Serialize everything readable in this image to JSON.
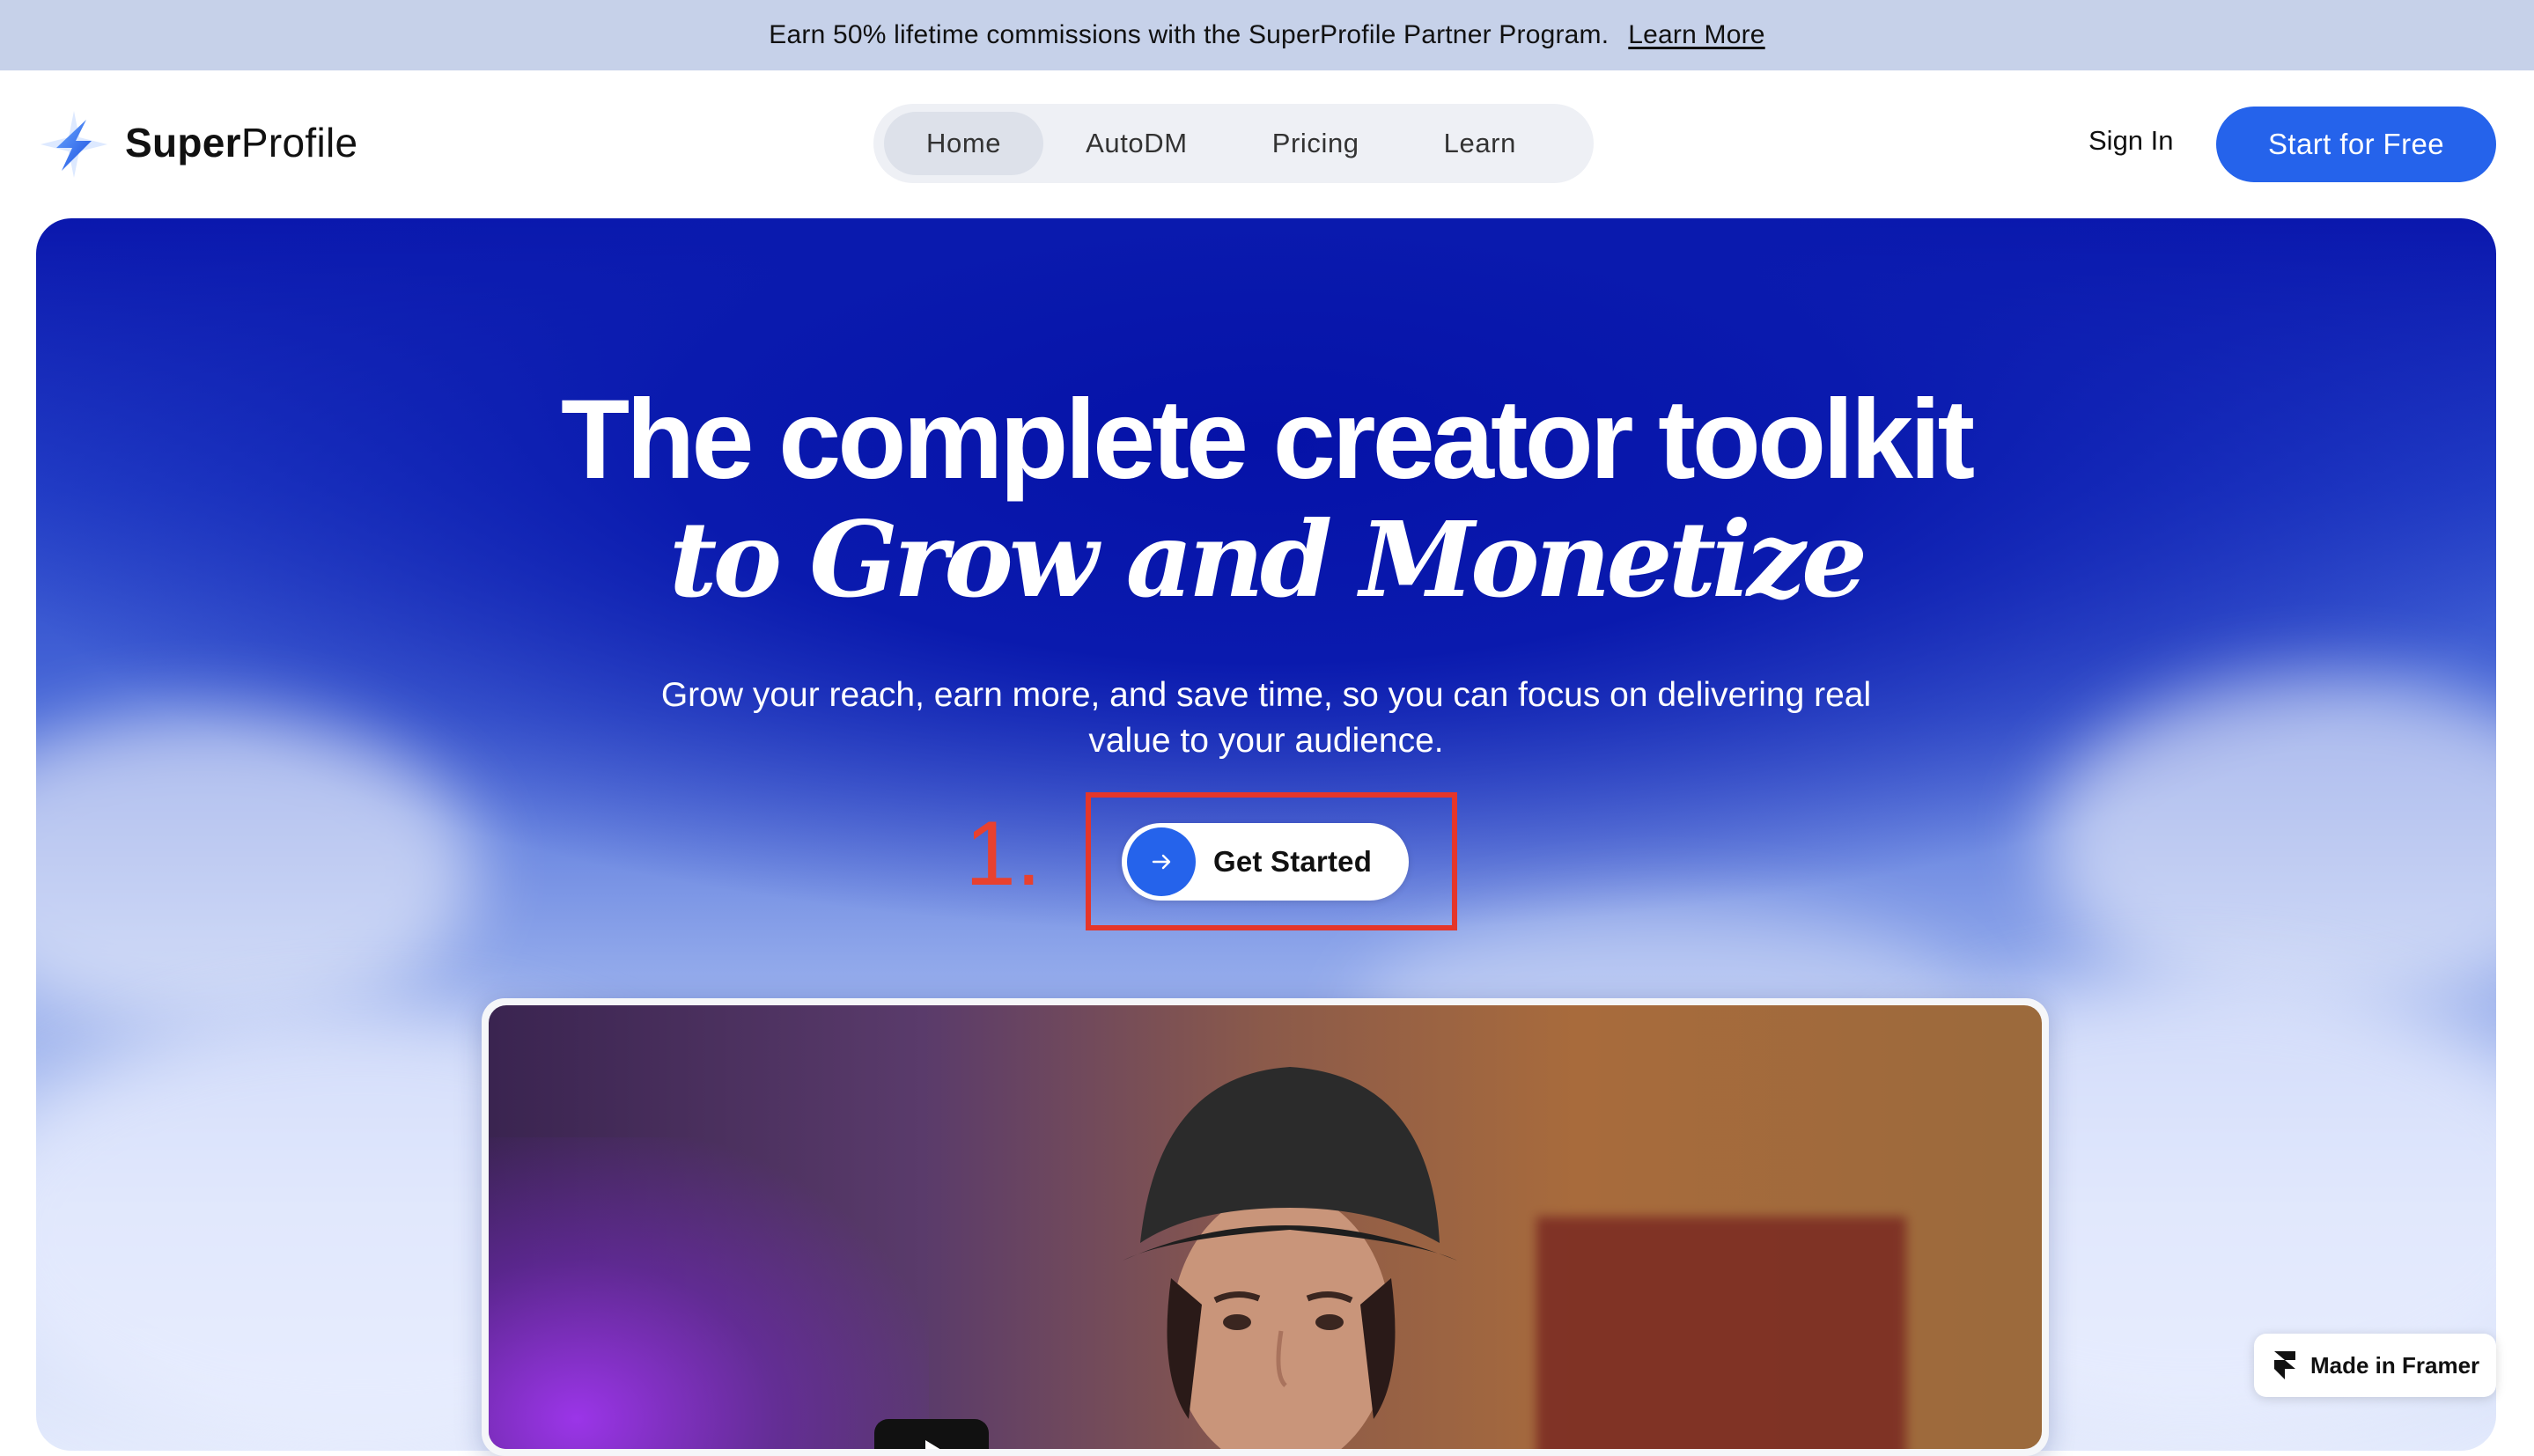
{
  "announcement": {
    "text": "Earn 50% lifetime commissions with the SuperProfile Partner Program.",
    "link": "Learn More"
  },
  "header": {
    "brand_bold": "Super",
    "brand_regular": "Profile",
    "logo_icon": "bolt-star-logo-icon",
    "nav": [
      {
        "label": "Home",
        "active": true
      },
      {
        "label": "AutoDM",
        "active": false
      },
      {
        "label": "Pricing",
        "active": false
      },
      {
        "label": "Learn",
        "active": false
      }
    ],
    "sign_in": "Sign In",
    "cta": "Start for Free"
  },
  "hero": {
    "title": "The complete creator toolkit",
    "subtitle": "to Grow and Monetize",
    "description": "Grow your reach, earn more, and save time, so you can focus on delivering real value to your audience.",
    "cta": "Get Started",
    "cta_icon": "arrow-right-icon",
    "annotation": "1."
  },
  "badge": {
    "label": "Made in Framer",
    "icon": "framer-logo-icon"
  },
  "colors": {
    "accent": "#2563eb",
    "announcement_bg": "#c6d1e9",
    "annotation_red": "#e5362a"
  }
}
